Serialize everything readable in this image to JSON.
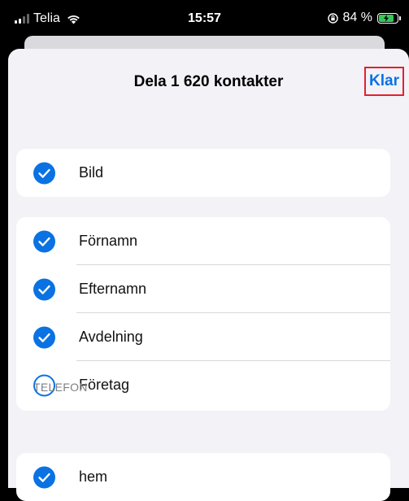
{
  "status_bar": {
    "carrier": "Telia",
    "time": "15:57",
    "battery_text": "84 %"
  },
  "sheet": {
    "title": "Dela 1 620 kontakter",
    "done_label": "Klar"
  },
  "groups": [
    {
      "items": [
        {
          "label": "Bild",
          "checked": true
        }
      ]
    },
    {
      "items": [
        {
          "label": "Förnamn",
          "checked": true
        },
        {
          "label": "Efternamn",
          "checked": true
        },
        {
          "label": "Avdelning",
          "checked": true
        },
        {
          "label": "Företag",
          "checked": false
        }
      ]
    }
  ],
  "sections": {
    "phone_header": "TELEFON",
    "phone_items": [
      {
        "label": "hem",
        "checked": true
      }
    ]
  },
  "colors": {
    "accent": "#0a72e3",
    "highlight_box": "#e3202f",
    "battery": "#35c759",
    "sheet_bg": "#f2f2f7"
  }
}
